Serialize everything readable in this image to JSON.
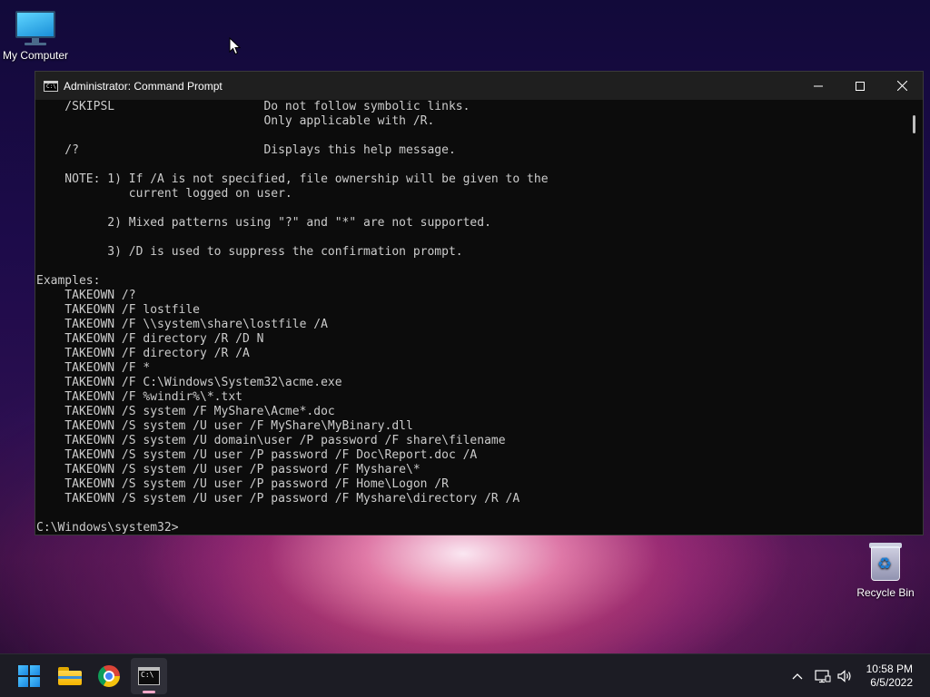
{
  "desktop": {
    "icons": [
      {
        "label": "My Computer",
        "icon": "monitor-icon"
      },
      {
        "label": "Recycle Bin",
        "icon": "recycle-bin-icon"
      }
    ]
  },
  "window": {
    "title": "Administrator: Command Prompt",
    "icon": "cmd-icon",
    "controls": {
      "minimize": "minimize-icon",
      "maximize": "maximize-icon",
      "close": "close-icon"
    },
    "console_lines": [
      "    /SKIPSL                     Do not follow symbolic links.",
      "                                Only applicable with /R.",
      "",
      "    /?                          Displays this help message.",
      "",
      "    NOTE: 1) If /A is not specified, file ownership will be given to the",
      "             current logged on user.",
      "",
      "          2) Mixed patterns using \"?\" and \"*\" are not supported.",
      "",
      "          3) /D is used to suppress the confirmation prompt.",
      "",
      "Examples:",
      "    TAKEOWN /?",
      "    TAKEOWN /F lostfile",
      "    TAKEOWN /F \\\\system\\share\\lostfile /A",
      "    TAKEOWN /F directory /R /D N",
      "    TAKEOWN /F directory /R /A",
      "    TAKEOWN /F *",
      "    TAKEOWN /F C:\\Windows\\System32\\acme.exe",
      "    TAKEOWN /F %windir%\\*.txt",
      "    TAKEOWN /S system /F MyShare\\Acme*.doc",
      "    TAKEOWN /S system /U user /F MyShare\\MyBinary.dll",
      "    TAKEOWN /S system /U domain\\user /P password /F share\\filename",
      "    TAKEOWN /S system /U user /P password /F Doc\\Report.doc /A",
      "    TAKEOWN /S system /U user /P password /F Myshare\\*",
      "    TAKEOWN /S system /U user /P password /F Home\\Logon /R",
      "    TAKEOWN /S system /U user /P password /F Myshare\\directory /R /A",
      "",
      "C:\\Windows\\system32>"
    ]
  },
  "taskbar": {
    "items": [
      {
        "name": "start",
        "icon": "windows-start-icon"
      },
      {
        "name": "file-explorer",
        "icon": "folder-icon"
      },
      {
        "name": "chrome",
        "icon": "chrome-icon"
      },
      {
        "name": "command-prompt",
        "icon": "cmd-icon",
        "active": true
      }
    ],
    "tray": {
      "icons": [
        "chevron-up-icon",
        "network-icon",
        "volume-icon"
      ],
      "time": "10:58 PM",
      "date": "6/5/2022"
    }
  }
}
